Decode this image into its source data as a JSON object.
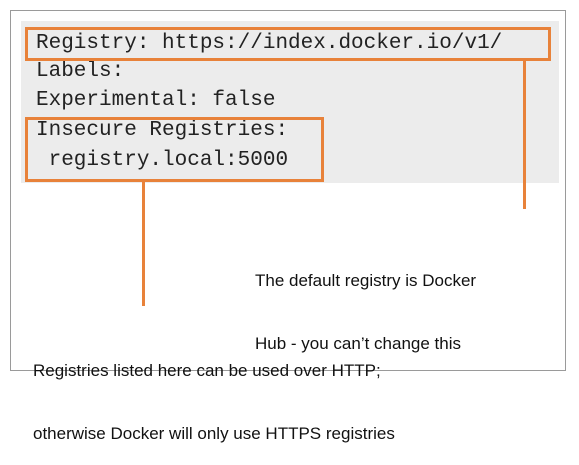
{
  "code": {
    "lines": [
      "Registry: https://index.docker.io/v1/",
      "Labels:",
      "Experimental: false",
      "Insecure Registries:",
      " registry.local:5000"
    ]
  },
  "annotations": {
    "default_registry": {
      "line1": "The default registry is Docker",
      "line2": "Hub - you can’t change this"
    },
    "insecure_registries": {
      "line1": "Registries listed here can be used over HTTP;",
      "line2": "otherwise Docker will only use HTTPS registries"
    }
  },
  "colors": {
    "highlight": "#e8823a",
    "code_background": "#ececec",
    "frame_border": "#9a9a9a"
  }
}
